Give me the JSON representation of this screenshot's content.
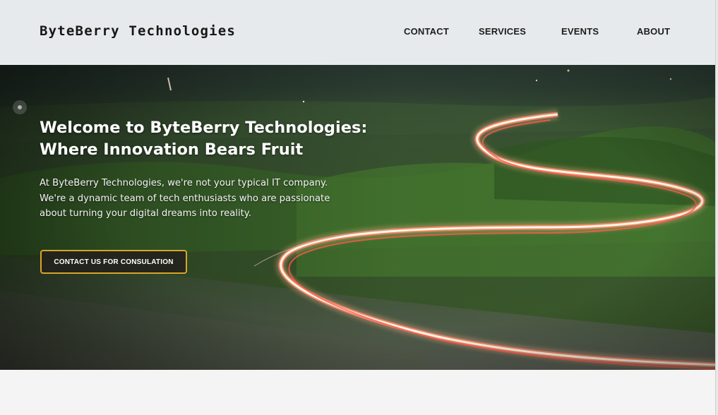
{
  "header": {
    "brand": "ByteBerry Technologies",
    "nav": [
      "CONTACT",
      "SERVICES",
      "EVENTS",
      "ABOUT"
    ]
  },
  "hero": {
    "title_line1": "Welcome to ByteBerry Technologies:",
    "title_line2": "Where Innovation Bears Fruit",
    "description": "At ByteBerry Technologies, we're not your typical IT company. We're a dynamic team of tech enthusiasts who are passionate about turning your digital dreams into reality.",
    "cta_label": "CONTACT US FOR CONSULATION"
  },
  "colors": {
    "header_bg": "#e7eaec",
    "cta_border": "#d8a52a",
    "page_bg": "#f4f4f4"
  }
}
